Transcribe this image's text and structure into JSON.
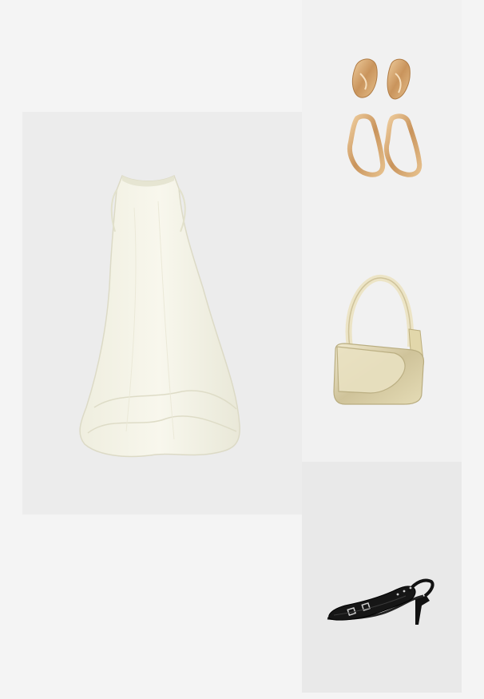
{
  "outfit": {
    "items": [
      {
        "id": "dress",
        "icon": "dress-icon",
        "color": "#f4f3e6"
      },
      {
        "id": "earrings",
        "icon": "earrings-icon",
        "color": "#cf9f67"
      },
      {
        "id": "bag",
        "icon": "handbag-icon",
        "color": "#d9cda0"
      },
      {
        "id": "shoes",
        "icon": "slingback-shoe-icon",
        "color": "#151515"
      }
    ]
  }
}
